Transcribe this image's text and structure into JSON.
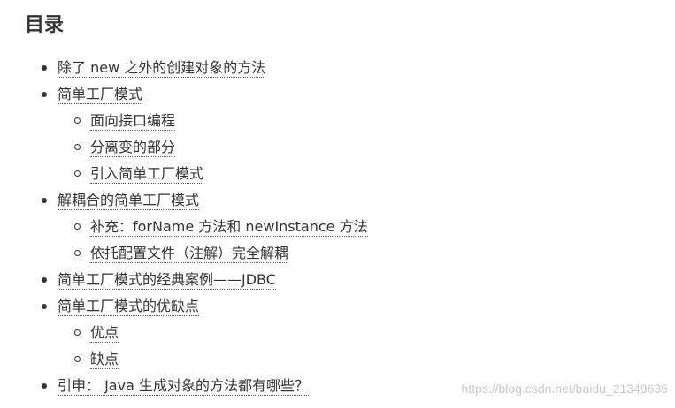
{
  "toc": {
    "title": "目录",
    "items": [
      {
        "label": "除了 new 之外的创建对象的方法",
        "children": []
      },
      {
        "label": "简单工厂模式",
        "children": [
          {
            "label": "面向接口编程"
          },
          {
            "label": "分离变的部分"
          },
          {
            "label": "引入简单工厂模式"
          }
        ]
      },
      {
        "label": "解耦合的简单工厂模式",
        "children": [
          {
            "label": "补充：forName 方法和 newInstance 方法"
          },
          {
            "label": "依托配置文件（注解）完全解耦"
          }
        ]
      },
      {
        "label": "简单工厂模式的经典案例——JDBC",
        "children": []
      },
      {
        "label": "简单工厂模式的优缺点",
        "children": [
          {
            "label": "优点"
          },
          {
            "label": "缺点"
          }
        ]
      },
      {
        "label": "引申： Java 生成对象的方法都有哪些？",
        "children": []
      }
    ]
  },
  "watermark": "https://blog.csdn.net/baidu_21349635",
  "colors": {
    "text": "#333333",
    "watermark": "#c9c9c9",
    "background": "#ffffff"
  }
}
